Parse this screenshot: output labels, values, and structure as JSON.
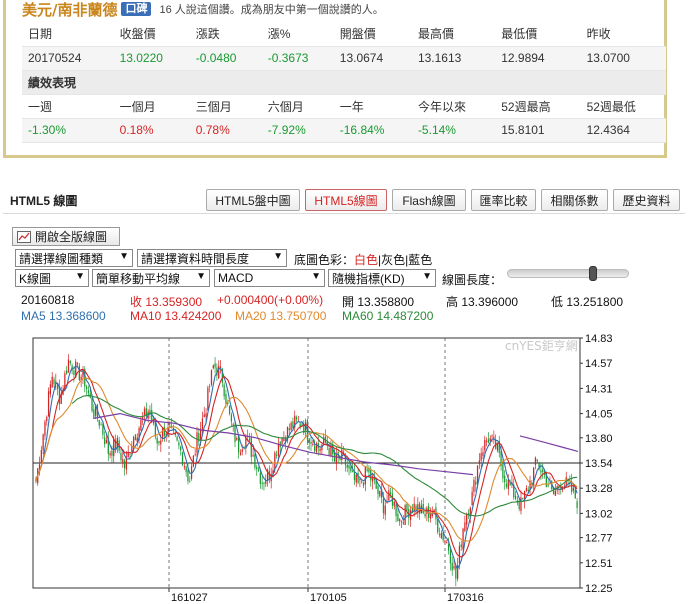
{
  "quote": {
    "pair_name": "美元/南非蘭德",
    "badge": "口碑",
    "note": "16 人說這個讚。成為朋友中第一個說讚的人。",
    "labels": [
      "日期",
      "收盤價",
      "漲跌",
      "漲%",
      "開盤價",
      "最高價",
      "最低價",
      "昨收"
    ],
    "values": [
      "20170524",
      "13.0220",
      "-0.0480",
      "-0.3673",
      "13.0674",
      "13.1613",
      "12.9894",
      "13.0700"
    ],
    "value_colors": [
      "dark",
      "green",
      "green",
      "green",
      "dark",
      "dark",
      "dark",
      "dark"
    ],
    "section_title": "績效表現",
    "perf_labels": [
      "一週",
      "一個月",
      "三個月",
      "六個月",
      "一年",
      "今年以來",
      "52週最高",
      "52週最低"
    ],
    "perf_values": [
      "-1.30%",
      "0.18%",
      "0.78%",
      "-7.92%",
      "-16.84%",
      "-5.14%",
      "15.8101",
      "12.4364"
    ],
    "perf_colors": [
      "green",
      "red",
      "red",
      "green",
      "green",
      "green",
      "dark",
      "dark"
    ]
  },
  "chart_panel": {
    "title": "HTML5 線圖",
    "tabs": [
      "HTML5盤中圖",
      "HTML5線圖",
      "Flash線圖",
      "匯率比較",
      "相關係數",
      "歷史資料"
    ],
    "active_tab": 1,
    "open_button": "開啟全版線圖",
    "select_chart_type": "請選擇線圖種類",
    "select_time_range": "請選擇資料時間長度",
    "bg_label": "底圖色彩：",
    "bg_white": "白色",
    "bg_gray": "灰色",
    "bg_blue": "藍色",
    "select_k": "K線圖",
    "select_ma": "簡單移動平均線",
    "select_macd": "MACD",
    "select_kd": "隨機指標(KD)",
    "chart_length_label": "線圖長度：",
    "info_date": "20160818",
    "info_close": "收 13.359300",
    "info_change": "+0.000400(+0.00%)",
    "info_open": "開 13.358800",
    "info_high": "高 13.396000",
    "info_low": "低 13.251800",
    "ma5": "MA5 13.368600",
    "ma10": "MA10 13.424200",
    "ma20": "MA20 13.750700",
    "ma60": "MA60 14.487200",
    "watermark": "cnYES鉅亨網",
    "colors": {
      "ma5": "#2f6fb0",
      "ma10": "#d62424",
      "ma20": "#e08a2e",
      "ma60": "#2d8a3a",
      "up": "#d62424",
      "down": "#1a9a32"
    }
  },
  "chart_data": {
    "type": "candlestick",
    "y_ticks": [
      "14.83",
      "14.57",
      "14.31",
      "14.05",
      "13.80",
      "13.54",
      "13.28",
      "13.02",
      "12.77",
      "12.51",
      "12.25"
    ],
    "ylim": [
      12.25,
      14.83
    ],
    "x_ticks": [
      "161027",
      "170105",
      "170316"
    ],
    "reference_line": 13.54,
    "close_path": [
      13.35,
      13.9,
      14.45,
      14.2,
      14.6,
      14.5,
      14.4,
      14.1,
      13.95,
      13.65,
      13.75,
      13.5,
      13.8,
      13.95,
      14.1,
      13.75,
      13.9,
      13.8,
      13.65,
      13.35,
      13.8,
      14.1,
      14.55,
      14.45,
      14.0,
      13.7,
      13.8,
      13.6,
      13.35,
      13.45,
      13.75,
      13.85,
      13.95,
      13.95,
      13.8,
      13.7,
      13.75,
      13.55,
      13.6,
      13.4,
      13.3,
      13.45,
      13.3,
      13.1,
      13.2,
      12.95,
      13.05,
      13.1,
      13.0,
      13.05,
      12.85,
      12.7,
      12.35,
      12.95,
      13.2,
      13.65,
      13.8,
      13.7,
      13.4,
      13.25,
      13.1,
      13.3,
      13.55,
      13.4,
      13.2,
      13.35,
      13.3,
      13.15
    ],
    "ma60_path": [
      14.0,
      14.05,
      13.98,
      13.95,
      13.88,
      13.85,
      13.8,
      13.72,
      13.65,
      13.6,
      13.55,
      13.52,
      13.48,
      13.45,
      13.42
    ],
    "ma60_tail": [
      13.82,
      13.78,
      13.74,
      13.7,
      13.66
    ]
  }
}
